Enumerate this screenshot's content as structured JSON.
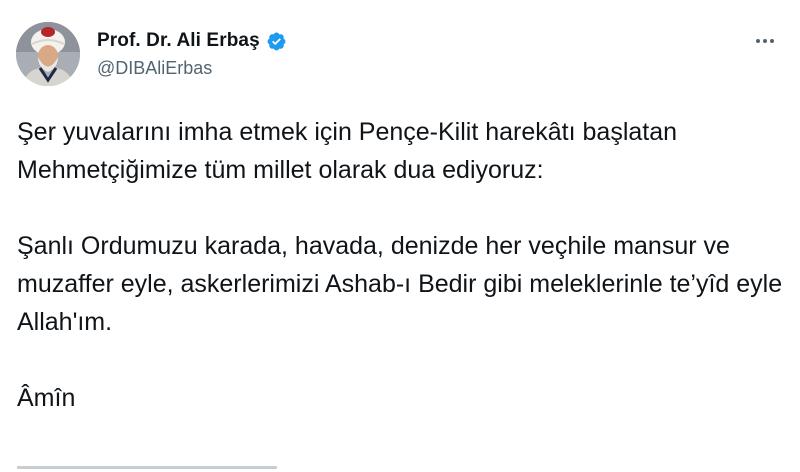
{
  "author": {
    "display_name": "Prof. Dr. Ali Erbaş",
    "handle": "@DIBAliErbas",
    "verified": true
  },
  "icons": {
    "verified": "verified-badge-icon",
    "more": "more-options-icon"
  },
  "colors": {
    "verified_blue": "#1d9bf0",
    "text": "#0f1419",
    "secondary_text": "#536471"
  },
  "tweet": {
    "paragraphs": [
      "Şer yuvalarını imha etmek için Pençe-Kilit harekâtı başlatan Mehmetçiğimize tüm millet olarak dua ediyoruz:",
      "Şanlı Ordumuzu karada, havada, denizde her veçhile mansur ve muzaffer eyle, askerlerimizi Ashab-ı Bedir gibi meleklerinle te’yîd eyle Allah'ım.",
      "Âmîn"
    ]
  }
}
